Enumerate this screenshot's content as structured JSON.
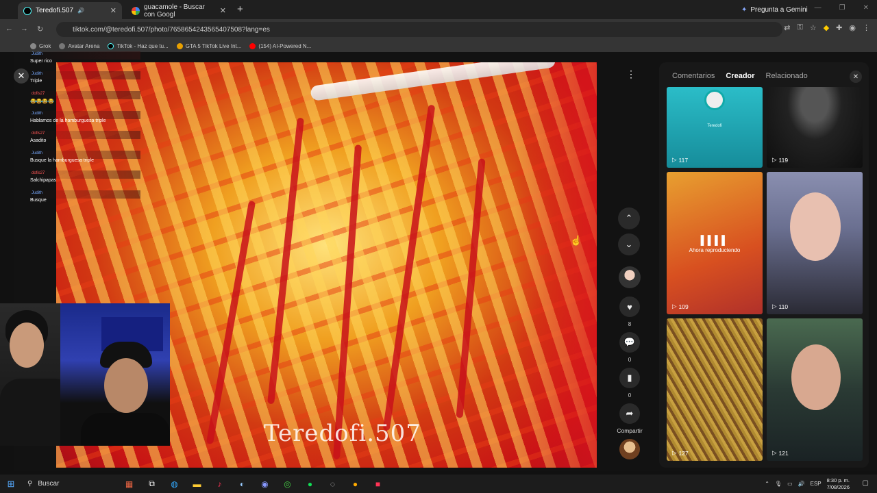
{
  "browser": {
    "tabs": [
      {
        "title": "Teredofi.507",
        "active": true
      },
      {
        "title": "guacamole - Buscar con Googl",
        "active": false
      }
    ],
    "new_tab_label": "+",
    "gemini_label": "Pregunta a Gemini",
    "url": "tiktok.com/@teredofi.507/photo/7658654243565407508?lang=es",
    "bookmarks": [
      "Grok",
      "Avatar Arena",
      "TikTok - Haz que tu...",
      "GTA 5 TikTok Live Int...",
      "(154) AI-Powered N..."
    ]
  },
  "chat": {
    "messages": [
      {
        "user": "Judith",
        "user_color": "blue",
        "text": "Super rico"
      },
      {
        "user": "Judith",
        "user_color": "blue",
        "text": "Triple"
      },
      {
        "user": "dofis27",
        "user_color": "red",
        "text": "😂😂😂😂"
      },
      {
        "user": "Judith",
        "user_color": "blue",
        "text": "Hablamos de la hamburguesa triple"
      },
      {
        "user": "dofis27",
        "user_color": "red",
        "text": "Asadito"
      },
      {
        "user": "Judith",
        "user_color": "blue",
        "text": "Busque la hamburguesa triple"
      },
      {
        "user": "dofis27",
        "user_color": "red",
        "text": "Salchipapas"
      },
      {
        "user": "Judith",
        "user_color": "blue",
        "text": "Busque"
      }
    ]
  },
  "post": {
    "watermark": "Teredofi.507",
    "like_count": "8",
    "comment_count": "0",
    "save_count": "0",
    "share_label": "Compartir"
  },
  "panel": {
    "tabs": [
      "Comentarios",
      "Creador",
      "Relacionado"
    ],
    "active_tab": "Creador",
    "now_playing_label": "Ahora reproduciendo",
    "thumbs": [
      {
        "views": "117",
        "caption": "Teredofi"
      },
      {
        "views": "119"
      },
      {
        "views": "109",
        "now_playing": true
      },
      {
        "views": "110"
      },
      {
        "views": "127"
      },
      {
        "views": "121"
      }
    ]
  },
  "taskbar": {
    "search_label": "Buscar",
    "lang": "ESP",
    "time": "8:30 p. m.",
    "date": "7/08/2026"
  },
  "colors": {
    "accent_red": "#fe2c55",
    "panel_bg": "#181818",
    "chrome_bg": "#353535"
  }
}
